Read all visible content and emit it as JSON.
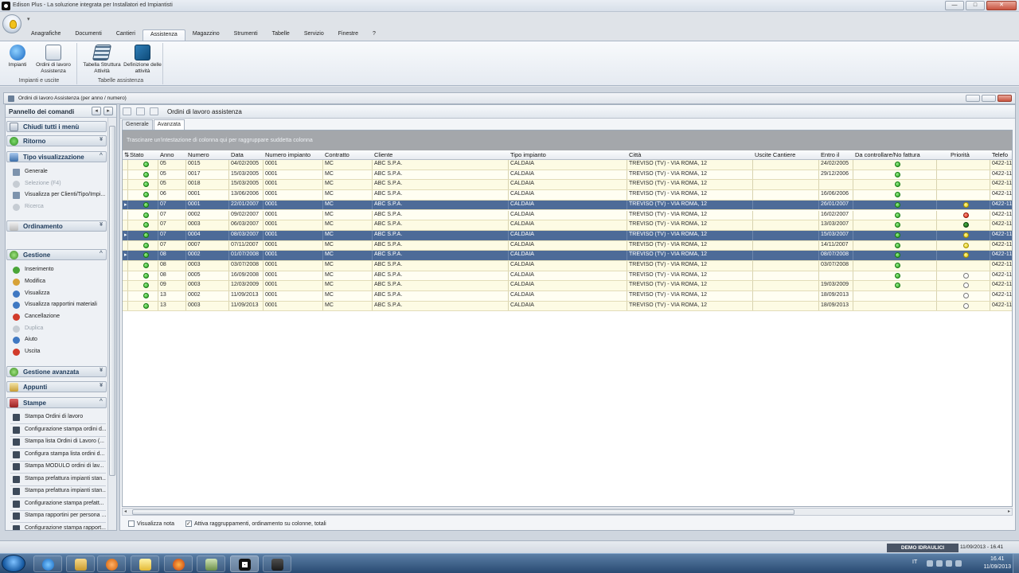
{
  "window": {
    "title": "Edison Plus - La soluzione integrata per Installatori ed Impiantisti",
    "min": "—",
    "max": "□",
    "close": "✕"
  },
  "qat": "▾",
  "ribbon": {
    "tabs": [
      "Anagrafiche",
      "Documenti",
      "Cantieri",
      "Assistenza",
      "Magazzino",
      "Strumenti",
      "Tabelle",
      "Servizio",
      "Finestre",
      "?"
    ],
    "active_tab": "Assistenza",
    "groups": [
      {
        "label": "Impianti e uscite",
        "buttons": [
          {
            "label": "Impianti",
            "icon": "globe-icon"
          },
          {
            "label": "Ordini di lavoro Assistenza",
            "icon": "work-order-icon"
          }
        ]
      },
      {
        "label": "Tabelle assistenza",
        "buttons": [
          {
            "label": "Tabella Struttura Attività",
            "icon": "table-structure-icon"
          },
          {
            "label": "Definizione delle attività",
            "icon": "activity-definition-icon"
          }
        ]
      }
    ]
  },
  "mdi": {
    "title": "Ordini di lavoro Assistenza (per anno / numero)"
  },
  "left_panel": {
    "title": "Pannello dei comandi",
    "nav_prev": "◂",
    "nav_next": "▸",
    "close_all": "Chiudi tutti i menù",
    "sections": {
      "ritorno": "Ritorno",
      "tipo_visualizzazione": "Tipo visualizzazione",
      "ordinamento": "Ordinamento",
      "gestione": "Gestione",
      "gestione_avanzata": "Gestione avanzata",
      "appunti": "Appunti",
      "stampe": "Stampe"
    },
    "tipo_items": [
      "Generale",
      "Selezione (F4)",
      "Visualizza per Clienti/Tipo/Impi...",
      "Ricerca"
    ],
    "gestione_items": [
      "Inserimento",
      "Modifica",
      "Visualizza",
      "Visualizza rapportini materiali",
      "Cancellazione",
      "Duplica",
      "Aiuto",
      "Uscita"
    ],
    "stampe_items": [
      "Stampa Ordini di lavoro",
      "Configurazione stampa ordini d...",
      "Stampa lista Ordini di Lavoro (...",
      "Configura stampa lista ordini d...",
      "Stampa MODULO ordini di lav...",
      "Stampa prefattura impianti stan...",
      "Stampa prefattura impianti stan...",
      "Configurazione stampa prefatt...",
      "Stampa rapportini per persona ...",
      "Configurazione stampa rapport..."
    ]
  },
  "main": {
    "title": "Ordini di lavoro assistenza",
    "subtabs": [
      "Generale",
      "Avanzata"
    ],
    "active_subtab": "Avanzata",
    "group_hint": "Trascinare un'intestazione di colonna qui per raggruppare suddetta colonna",
    "columns": [
      "Stato",
      "Anno",
      "Numero",
      "Data",
      "Numero impianto",
      "Contratto",
      "Cliente",
      "Tipo impianto",
      "Città",
      "Uscite Cantiere",
      "Entro il",
      "Da controllare/No fattura",
      "Priorità",
      "Telefo"
    ],
    "rows": [
      {
        "ind": "",
        "stato": "green",
        "anno": "05",
        "numero": "0015",
        "data": "04/02/2005",
        "impianto": "0001",
        "contratto": "MC",
        "cliente": "ABC S.P.A.",
        "tipo": "CALDAIA",
        "citta": "TREVISO (TV) - VIA ROMA, 12",
        "uscite": "",
        "entro": "24/02/2005",
        "controllo": "green",
        "priorita": "",
        "tel": "0422-11",
        "sel": false
      },
      {
        "ind": "",
        "stato": "green",
        "anno": "05",
        "numero": "0017",
        "data": "15/03/2005",
        "impianto": "0001",
        "contratto": "MC",
        "cliente": "ABC S.P.A.",
        "tipo": "CALDAIA",
        "citta": "TREVISO (TV) - VIA ROMA, 12",
        "uscite": "",
        "entro": "29/12/2006",
        "controllo": "green",
        "priorita": "",
        "tel": "0422-11",
        "sel": false
      },
      {
        "ind": "",
        "stato": "green",
        "anno": "05",
        "numero": "0018",
        "data": "15/03/2005",
        "impianto": "0001",
        "contratto": "MC",
        "cliente": "ABC S.P.A.",
        "tipo": "CALDAIA",
        "citta": "TREVISO (TV) - VIA ROMA, 12",
        "uscite": "",
        "entro": "",
        "controllo": "green",
        "priorita": "",
        "tel": "0422-11",
        "sel": false
      },
      {
        "ind": "",
        "stato": "green",
        "anno": "06",
        "numero": "0001",
        "data": "13/06/2006",
        "impianto": "0001",
        "contratto": "MC",
        "cliente": "ABC S.P.A.",
        "tipo": "CALDAIA",
        "citta": "TREVISO (TV) - VIA ROMA, 12",
        "uscite": "",
        "entro": "16/06/2006",
        "controllo": "green",
        "priorita": "",
        "tel": "0422-11",
        "sel": false
      },
      {
        "ind": "▸",
        "stato": "green",
        "anno": "07",
        "numero": "0001",
        "data": "22/01/2007",
        "impianto": "0001",
        "contratto": "MC",
        "cliente": "ABC S.P.A.",
        "tipo": "CALDAIA",
        "citta": "TREVISO (TV) - VIA ROMA, 12",
        "uscite": "",
        "entro": "26/01/2007",
        "controllo": "green",
        "priorita": "yellow",
        "tel": "0422-11",
        "sel": true
      },
      {
        "ind": "",
        "stato": "green",
        "anno": "07",
        "numero": "0002",
        "data": "09/02/2007",
        "impianto": "0001",
        "contratto": "MC",
        "cliente": "ABC S.P.A.",
        "tipo": "CALDAIA",
        "citta": "TREVISO (TV) - VIA ROMA, 12",
        "uscite": "",
        "entro": "16/02/2007",
        "controllo": "green",
        "priorita": "red",
        "tel": "0422-11",
        "sel": false
      },
      {
        "ind": "",
        "stato": "green",
        "anno": "07",
        "numero": "0003",
        "data": "06/03/2007",
        "impianto": "0001",
        "contratto": "MC",
        "cliente": "ABC S.P.A.",
        "tipo": "CALDAIA",
        "citta": "TREVISO (TV) - VIA ROMA, 12",
        "uscite": "",
        "entro": "13/03/2007",
        "controllo": "green",
        "priorita": "darkgreen",
        "tel": "0422-11",
        "sel": false
      },
      {
        "ind": "▸",
        "stato": "green",
        "anno": "07",
        "numero": "0004",
        "data": "08/03/2007",
        "impianto": "0001",
        "contratto": "MC",
        "cliente": "ABC S.P.A.",
        "tipo": "CALDAIA",
        "citta": "TREVISO (TV) - VIA ROMA, 12",
        "uscite": "",
        "entro": "15/03/2007",
        "controllo": "green",
        "priorita": "yellow",
        "tel": "0422-11",
        "sel": true
      },
      {
        "ind": "",
        "stato": "green",
        "anno": "07",
        "numero": "0007",
        "data": "07/11/2007",
        "impianto": "0001",
        "contratto": "MC",
        "cliente": "ABC S.P.A.",
        "tipo": "CALDAIA",
        "citta": "TREVISO (TV) - VIA ROMA, 12",
        "uscite": "",
        "entro": "14/11/2007",
        "controllo": "green",
        "priorita": "yellow",
        "tel": "0422-11",
        "sel": false
      },
      {
        "ind": "▸",
        "stato": "green",
        "anno": "08",
        "numero": "0002",
        "data": "01/07/2008",
        "impianto": "0001",
        "contratto": "MC",
        "cliente": "ABC S.P.A.",
        "tipo": "CALDAIA",
        "citta": "TREVISO (TV) - VIA ROMA, 12",
        "uscite": "",
        "entro": "08/07/2008",
        "controllo": "green",
        "priorita": "yellow",
        "tel": "0422-11",
        "sel": true
      },
      {
        "ind": "",
        "stato": "green",
        "anno": "08",
        "numero": "0003",
        "data": "03/07/2008",
        "impianto": "0001",
        "contratto": "MC",
        "cliente": "ABC S.P.A.",
        "tipo": "CALDAIA",
        "citta": "TREVISO (TV) - VIA ROMA, 12",
        "uscite": "",
        "entro": "03/07/2008",
        "controllo": "green",
        "priorita": "",
        "tel": "0422-11",
        "sel": false
      },
      {
        "ind": "",
        "stato": "green",
        "anno": "08",
        "numero": "0005",
        "data": "16/09/2008",
        "impianto": "0001",
        "contratto": "MC",
        "cliente": "ABC S.P.A.",
        "tipo": "CALDAIA",
        "citta": "TREVISO (TV) - VIA ROMA, 12",
        "uscite": "",
        "entro": "",
        "controllo": "green",
        "priorita": "empty",
        "tel": "0422-11",
        "sel": false
      },
      {
        "ind": "",
        "stato": "green",
        "anno": "09",
        "numero": "0003",
        "data": "12/03/2009",
        "impianto": "0001",
        "contratto": "MC",
        "cliente": "ABC S.P.A.",
        "tipo": "CALDAIA",
        "citta": "TREVISO (TV) - VIA ROMA, 12",
        "uscite": "",
        "entro": "19/03/2009",
        "controllo": "green",
        "priorita": "empty",
        "tel": "0422-11",
        "sel": false
      },
      {
        "ind": "",
        "stato": "green",
        "anno": "13",
        "numero": "0002",
        "data": "11/09/2013",
        "impianto": "0001",
        "contratto": "MC",
        "cliente": "ABC S.P.A.",
        "tipo": "CALDAIA",
        "citta": "TREVISO (TV) - VIA ROMA, 12",
        "uscite": "",
        "entro": "18/09/2013",
        "controllo": "",
        "priorita": "empty",
        "tel": "0422-11",
        "sel": false
      },
      {
        "ind": "",
        "stato": "green",
        "anno": "13",
        "numero": "0003",
        "data": "11/09/2013",
        "impianto": "0001",
        "contratto": "MC",
        "cliente": "ABC S.P.A.",
        "tipo": "CALDAIA",
        "citta": "TREVISO (TV) - VIA ROMA, 12",
        "uscite": "",
        "entro": "18/09/2013",
        "controllo": "",
        "priorita": "empty",
        "tel": "0422-11",
        "sel": false
      }
    ],
    "opt_nota": "Visualizza nota",
    "opt_nota_checked": false,
    "opt_raggr": "Attiva raggruppamenti, ordinamento su colonne, totali",
    "opt_raggr_checked": true
  },
  "status": {
    "user": "DEMO IDRAULICI",
    "datetime": "11/09/2013 - 16.41"
  },
  "taskbar": {
    "lang": "IT",
    "time": "16.41",
    "date": "11/09/2013"
  },
  "colors": {
    "selected_row": "#4d6b98",
    "row_even": "#fdfbe4",
    "row_odd": "#fffef2"
  }
}
